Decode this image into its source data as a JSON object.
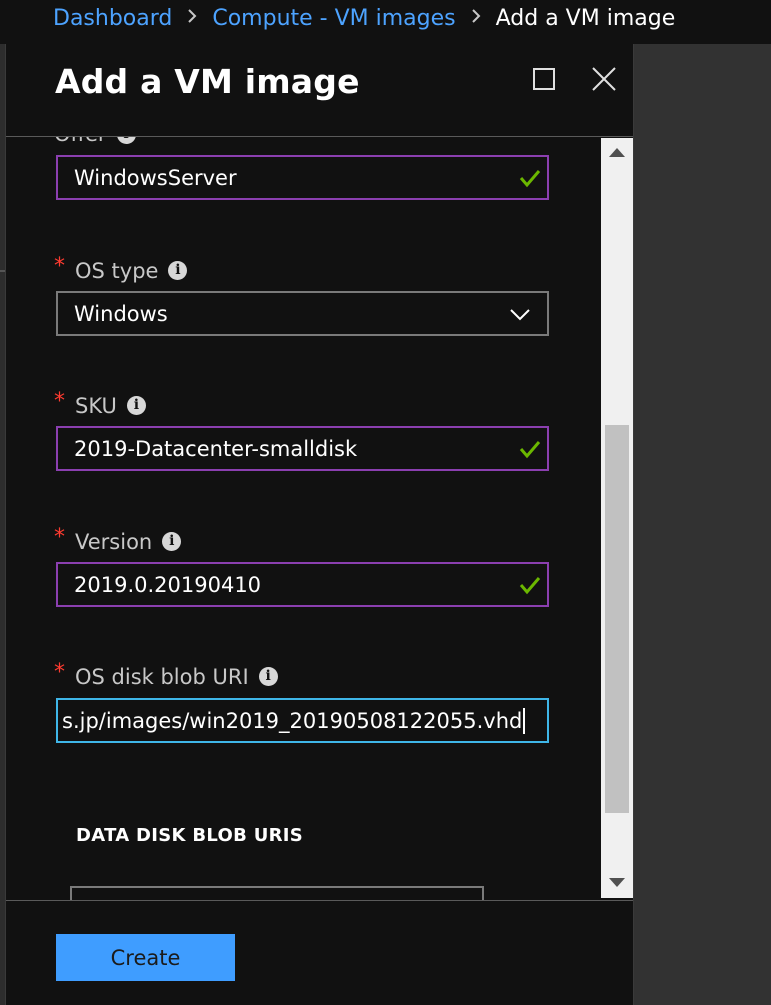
{
  "breadcrumb": {
    "items": [
      {
        "label": "Dashboard"
      },
      {
        "label": "Compute - VM images"
      }
    ],
    "current": "Add a VM image"
  },
  "blade": {
    "title": "Add a VM image"
  },
  "form": {
    "offer": {
      "label": "Offer",
      "value": "WindowsServer",
      "valid": true
    },
    "os_type": {
      "label": "OS type",
      "value": "Windows",
      "required": true
    },
    "sku": {
      "label": "SKU",
      "value": "2019-Datacenter-smalldisk",
      "required": true,
      "valid": true
    },
    "version": {
      "label": "Version",
      "value": "2019.0.20190410",
      "required": true,
      "valid": true
    },
    "os_disk_blob_uri": {
      "label": "OS disk blob URI",
      "value": "s.jp/images/win2019_20190508122055.vhd",
      "required": true
    },
    "data_disk_heading": "DATA DISK BLOB URIS"
  },
  "footer": {
    "create_label": "Create"
  },
  "colors": {
    "accent": "#3f9dff",
    "valid_border": "#8b3fb0",
    "focus_border": "#3fb6e8",
    "check": "#6bb700",
    "required": "#ff3b30",
    "link": "#4da3ff"
  },
  "icons": {
    "info": "info-icon",
    "check": "checkmark-icon",
    "chevron": "chevron-down-icon",
    "separator": "chevron-right-icon",
    "maximize": "maximize-icon",
    "close": "close-icon"
  },
  "scrollbar": {
    "position": 0.38
  }
}
